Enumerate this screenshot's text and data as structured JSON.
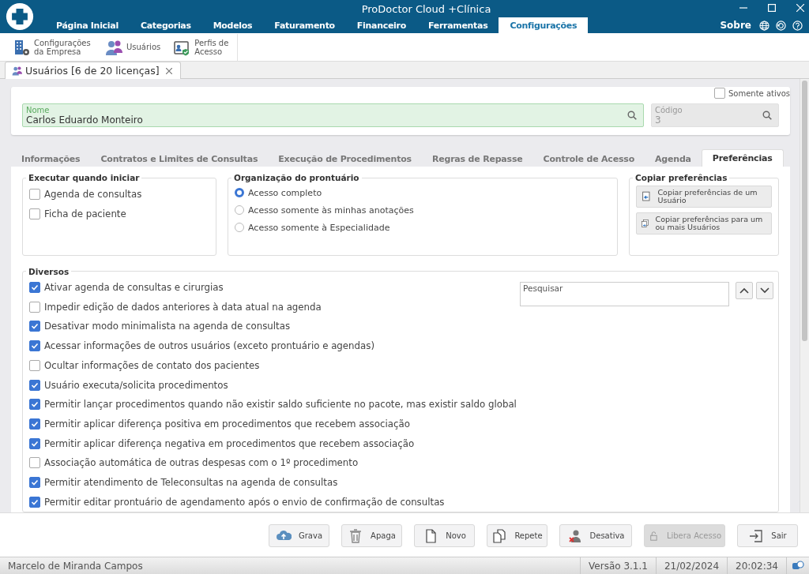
{
  "window": {
    "title": "ProDoctor Cloud +Clínica"
  },
  "menu": [
    {
      "label": "Página Inicial",
      "selected": false
    },
    {
      "label": "Categorias",
      "selected": false
    },
    {
      "label": "Modelos",
      "selected": false
    },
    {
      "label": "Faturamento",
      "selected": false
    },
    {
      "label": "Financeiro",
      "selected": false
    },
    {
      "label": "Ferramentas",
      "selected": false
    },
    {
      "label": "Configurações",
      "selected": true
    }
  ],
  "header_link": "Sobre",
  "toolbar": [
    {
      "label": "Configurações da Empresa",
      "kind": "building"
    },
    {
      "label": "Usuários",
      "kind": "users"
    },
    {
      "label": "Perfis de Acesso",
      "kind": "profile"
    }
  ],
  "document_tabs": [
    {
      "label": "Usuários [6 de 20 licenças]",
      "selected": true
    }
  ],
  "filter": {
    "label": "Somente ativos",
    "checked": false
  },
  "name_field": {
    "label": "Nome",
    "value": "Carlos Eduardo Monteiro"
  },
  "code_field": {
    "label": "Código",
    "value": "3"
  },
  "tabs": [
    {
      "label": "Informações",
      "selected": false
    },
    {
      "label": "Contratos e Limites de Consultas",
      "selected": false
    },
    {
      "label": "Execução de Procedimentos",
      "selected": false
    },
    {
      "label": "Regras de Repasse",
      "selected": false
    },
    {
      "label": "Controle de Acesso",
      "selected": false
    },
    {
      "label": "Agenda",
      "selected": false
    },
    {
      "label": "Preferências",
      "selected": true
    }
  ],
  "startup_group": {
    "title": "Executar quando iniciar",
    "items": [
      {
        "label": "Agenda de consultas",
        "checked": false
      },
      {
        "label": "Ficha de paciente",
        "checked": false
      }
    ]
  },
  "record_group": {
    "title": "Organização do prontuário",
    "options": [
      {
        "label": "Acesso completo",
        "selected": true
      },
      {
        "label": "Acesso somente às minhas anotações",
        "selected": false
      },
      {
        "label": "Acesso somente à Especialidade",
        "selected": false
      }
    ]
  },
  "copy_group": {
    "title": "Copiar preferências",
    "buttons": [
      {
        "label": "Copiar preferências de um Usuário",
        "kind": "from"
      },
      {
        "label": "Copiar preferências para um ou mais Usuários",
        "kind": "to"
      }
    ]
  },
  "misc_group": {
    "title": "Diversos",
    "search": {
      "placeholder": "Pesquisar"
    },
    "items": [
      {
        "label": "Ativar agenda de consultas e cirurgias",
        "checked": true
      },
      {
        "label": "Impedir edição de dados anteriores à data atual na agenda",
        "checked": false
      },
      {
        "label": "Desativar modo minimalista na agenda de consultas",
        "checked": true
      },
      {
        "label": "Acessar informações de outros usuários (exceto prontuário e agendas)",
        "checked": true
      },
      {
        "label": "Ocultar informações de contato dos pacientes",
        "checked": false
      },
      {
        "label": "Usuário executa/solicita procedimentos",
        "checked": true
      },
      {
        "label": "Permitir lançar procedimentos quando não existir saldo suficiente no pacote, mas existir saldo global",
        "checked": true
      },
      {
        "label": "Permitir aplicar diferença positiva em procedimentos que recebem associação",
        "checked": true
      },
      {
        "label": "Permitir aplicar diferença negativa em procedimentos que recebem associação",
        "checked": true
      },
      {
        "label": "Associação automática de outras despesas com o 1º procedimento",
        "checked": false
      },
      {
        "label": "Permitir atendimento de Teleconsultas na agenda de consultas",
        "checked": true
      },
      {
        "label": "Permitir editar prontuário de agendamento após o envio de confirmação de consultas",
        "checked": true
      }
    ]
  },
  "actions": [
    {
      "label": "Grava",
      "kind": "save",
      "disabled": false
    },
    {
      "label": "Apaga",
      "kind": "delete",
      "disabled": false
    },
    {
      "label": "Novo",
      "kind": "new",
      "disabled": false
    },
    {
      "label": "Repete",
      "kind": "copy",
      "disabled": false
    },
    {
      "label": "Desativa",
      "kind": "deactivate",
      "disabled": false
    },
    {
      "label": "Libera Acesso",
      "kind": "unlock",
      "disabled": true
    },
    {
      "label": "Sair",
      "kind": "exit",
      "disabled": false
    }
  ],
  "status_bar": {
    "user": "Marcelo de Miranda Campos",
    "version": "Versão 3.1.1",
    "date": "21/02/2024",
    "time": "20:02:34"
  }
}
